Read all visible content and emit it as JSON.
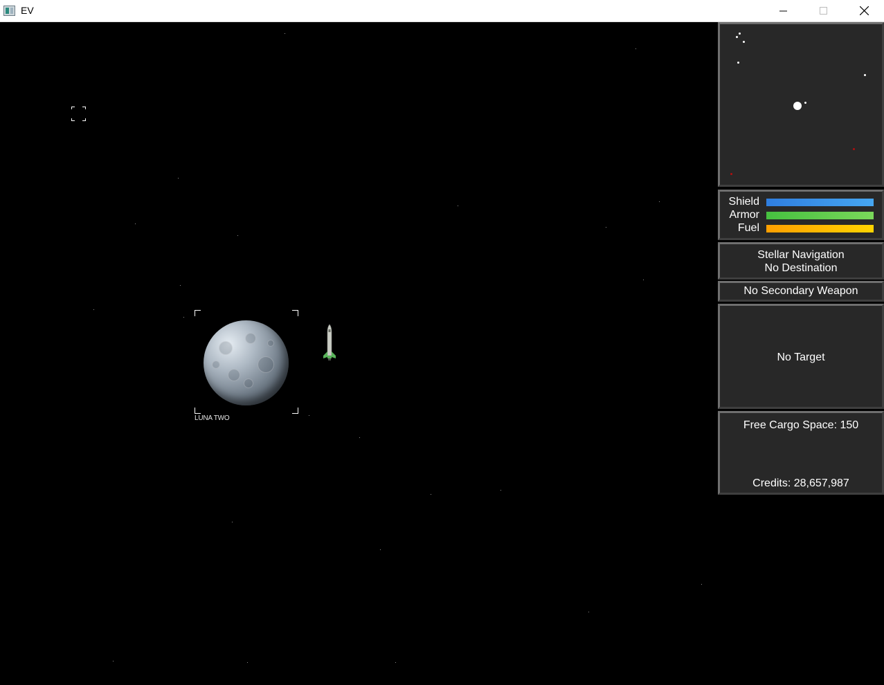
{
  "window": {
    "title": "EV",
    "minimize_glyph": "—",
    "maximize_glyph": "☐",
    "close_glyph": "✕"
  },
  "viewport": {
    "planet": {
      "name": "LUNA TWO"
    }
  },
  "hud": {
    "status": {
      "shield": {
        "label": "Shield",
        "level": 1.0,
        "color": "#3a8fe8"
      },
      "armor": {
        "label": "Armor",
        "level": 1.0,
        "color": "#52c84a"
      },
      "fuel": {
        "label": "Fuel",
        "level": 1.0,
        "color": "#ffb300"
      }
    },
    "navigation": {
      "line1": "Stellar Navigation",
      "line2": "No Destination"
    },
    "secondary_weapon": "No Secondary Weapon",
    "target": "No Target",
    "cargo": {
      "free_cargo": "Free Cargo Space: 150",
      "credits": "Credits: 28,657,987"
    }
  }
}
